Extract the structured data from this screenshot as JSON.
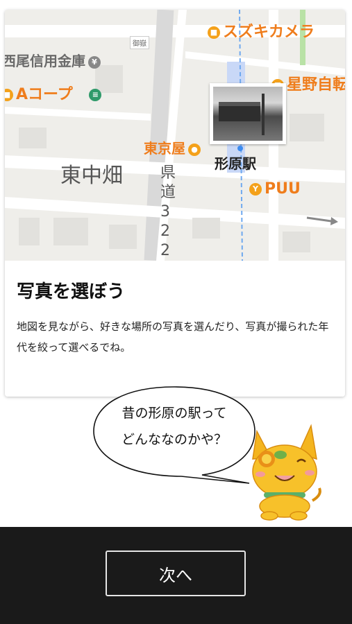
{
  "map": {
    "pois": {
      "suzuki_camera": "スズキカメラ",
      "nishio_shinkin": "西尾信用金庫",
      "a_coop": "Aコープ",
      "hoshino": "星野自転",
      "tokyoya": "東京屋",
      "puu": "PUU",
      "gokoku": "御嶽"
    },
    "area_label": "東中畑",
    "road_label": "県道322",
    "station_label": "形原駅"
  },
  "card": {
    "title": "写真を選ぼう",
    "description": "地図を見ながら、好きな場所の写真を選んだり、写真が撮られた年代を絞って選べるでね。"
  },
  "bubble": {
    "line1": "昔の形原の駅って",
    "line2": "どんななのかや？"
  },
  "footer": {
    "next_label": "次へ"
  },
  "colors": {
    "poi_orange": "#ef7d1c",
    "rail_blue": "#6fa9ef",
    "footer_bg": "#1a1a1a"
  }
}
